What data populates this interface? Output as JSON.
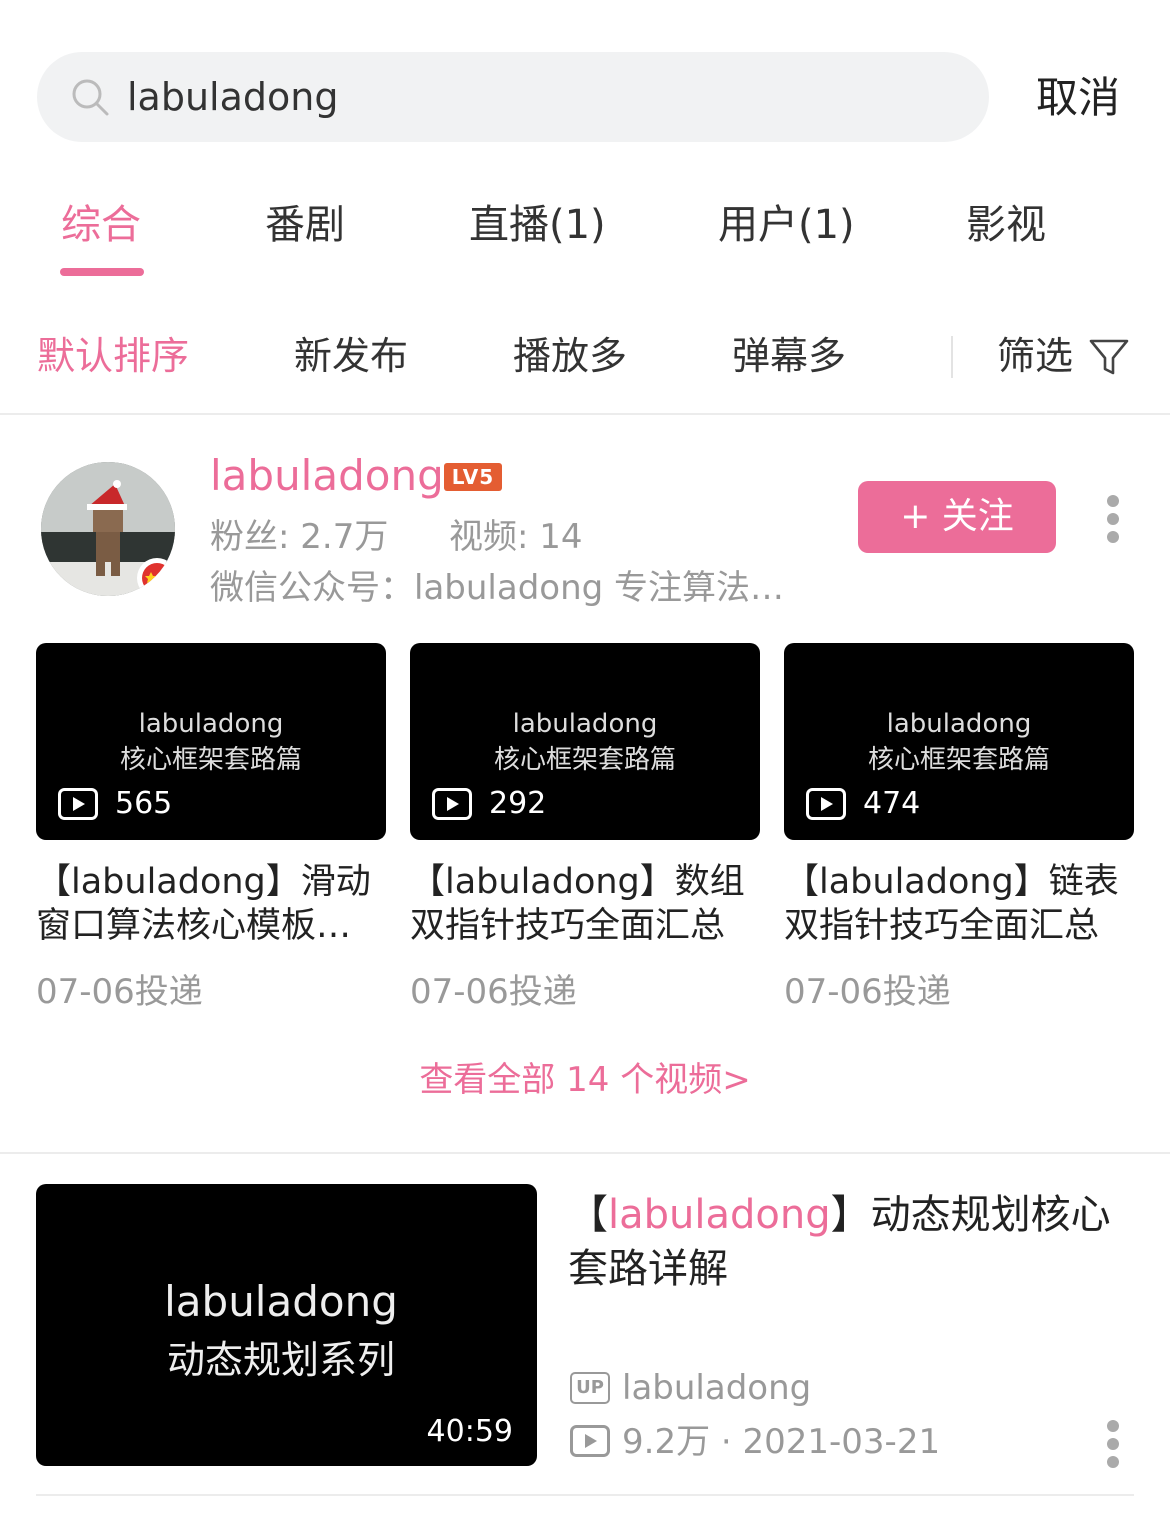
{
  "search": {
    "value": "labuladong",
    "cancel_label": "取消"
  },
  "tabs": [
    {
      "label": "综合",
      "active": true
    },
    {
      "label": "番剧"
    },
    {
      "label": "直播(1)"
    },
    {
      "label": "用户(1)"
    },
    {
      "label": "影视"
    }
  ],
  "sort": {
    "options": [
      "默认排序",
      "新发布",
      "播放多",
      "弹幕多"
    ],
    "active_index": 0,
    "filter_label": "筛选"
  },
  "user_card": {
    "name": "labuladong",
    "level": "LV5",
    "fans": "粉丝: 2.7万",
    "videos": "视频: 14",
    "description": "微信公众号：labuladong 专注算法…",
    "follow_label": "+ 关注"
  },
  "user_videos": [
    {
      "thumb_line1": "labuladong",
      "thumb_line2": "核心框架套路篇",
      "count": "565",
      "title": "【labuladong】滑动窗口算法核心模板…",
      "date": "07-06投递"
    },
    {
      "thumb_line1": "labuladong",
      "thumb_line2": "核心框架套路篇",
      "count": "292",
      "title": "【labuladong】数组双指针技巧全面汇总",
      "date": "07-06投递"
    },
    {
      "thumb_line1": "labuladong",
      "thumb_line2": "核心框架套路篇",
      "count": "474",
      "title": "【labuladong】链表双指针技巧全面汇总",
      "date": "07-06投递"
    }
  ],
  "see_all": "查看全部 14 个视频>",
  "result": {
    "thumb_line1": "labuladong",
    "thumb_line2": "动态规划系列",
    "duration": "40:59",
    "title_prefix": "【",
    "title_highlight": "labuladong",
    "title_rest": "】动态规划核心套路详解",
    "up_badge": "UP",
    "up_name": "labuladong",
    "views": "9.2万 · 2021-03-21"
  },
  "colors": {
    "accent": "#ec6d99",
    "muted": "#999999",
    "level_badge": "#e45d32"
  }
}
